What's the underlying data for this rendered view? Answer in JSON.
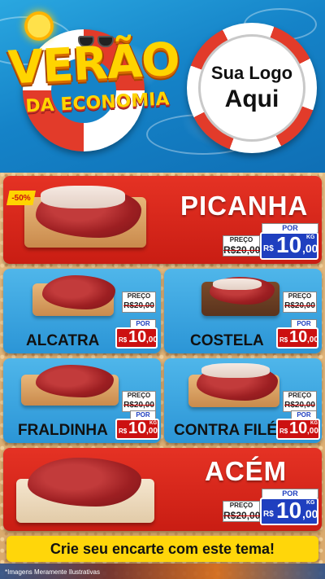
{
  "header": {
    "title_line1": "VERÃO",
    "title_line2": "DA ECONOMIA",
    "logo_line1": "Sua Logo",
    "logo_line2": "Aqui"
  },
  "discount_badge": "-50%",
  "products": [
    {
      "name": "PICANHA",
      "preco_label": "PREÇO",
      "old_price": "R$20,00",
      "por_label": "POR",
      "currency": "R$",
      "price_int": "10",
      "price_cents": ",00",
      "unit": "KG"
    },
    {
      "name": "ALCATRA",
      "preco_label": "PREÇO",
      "old_price": "R$20,00",
      "por_label": "POR",
      "currency": "R$",
      "price_int": "10",
      "price_cents": ",00"
    },
    {
      "name": "COSTELA",
      "preco_label": "PREÇO",
      "old_price": "R$20,00",
      "por_label": "POR",
      "currency": "R$",
      "price_int": "10",
      "price_cents": ",00"
    },
    {
      "name": "FRALDINHA",
      "preco_label": "PREÇO",
      "old_price": "R$20,00",
      "por_label": "POR",
      "currency": "R$",
      "price_int": "10",
      "price_cents": ",00",
      "unit": "KG"
    },
    {
      "name": "CONTRA FILÉ",
      "preco_label": "PREÇO",
      "old_price": "R$20,00",
      "por_label": "POR",
      "currency": "R$",
      "price_int": "10",
      "price_cents": ",00",
      "unit": "KG"
    },
    {
      "name": "ACÉM",
      "preco_label": "PREÇO",
      "old_price": "R$20,00",
      "por_label": "POR",
      "currency": "R$",
      "price_int": "10",
      "price_cents": ",00",
      "unit": "KG"
    }
  ],
  "cta": "Crie seu encarte com este tema!",
  "footnote": "*Imagens Meramente Ilustrativas",
  "colors": {
    "red": "#e53224",
    "blue_panel": "#3aa6e2",
    "price_blue": "#1f3fbf",
    "yellow": "#ffd60a"
  }
}
